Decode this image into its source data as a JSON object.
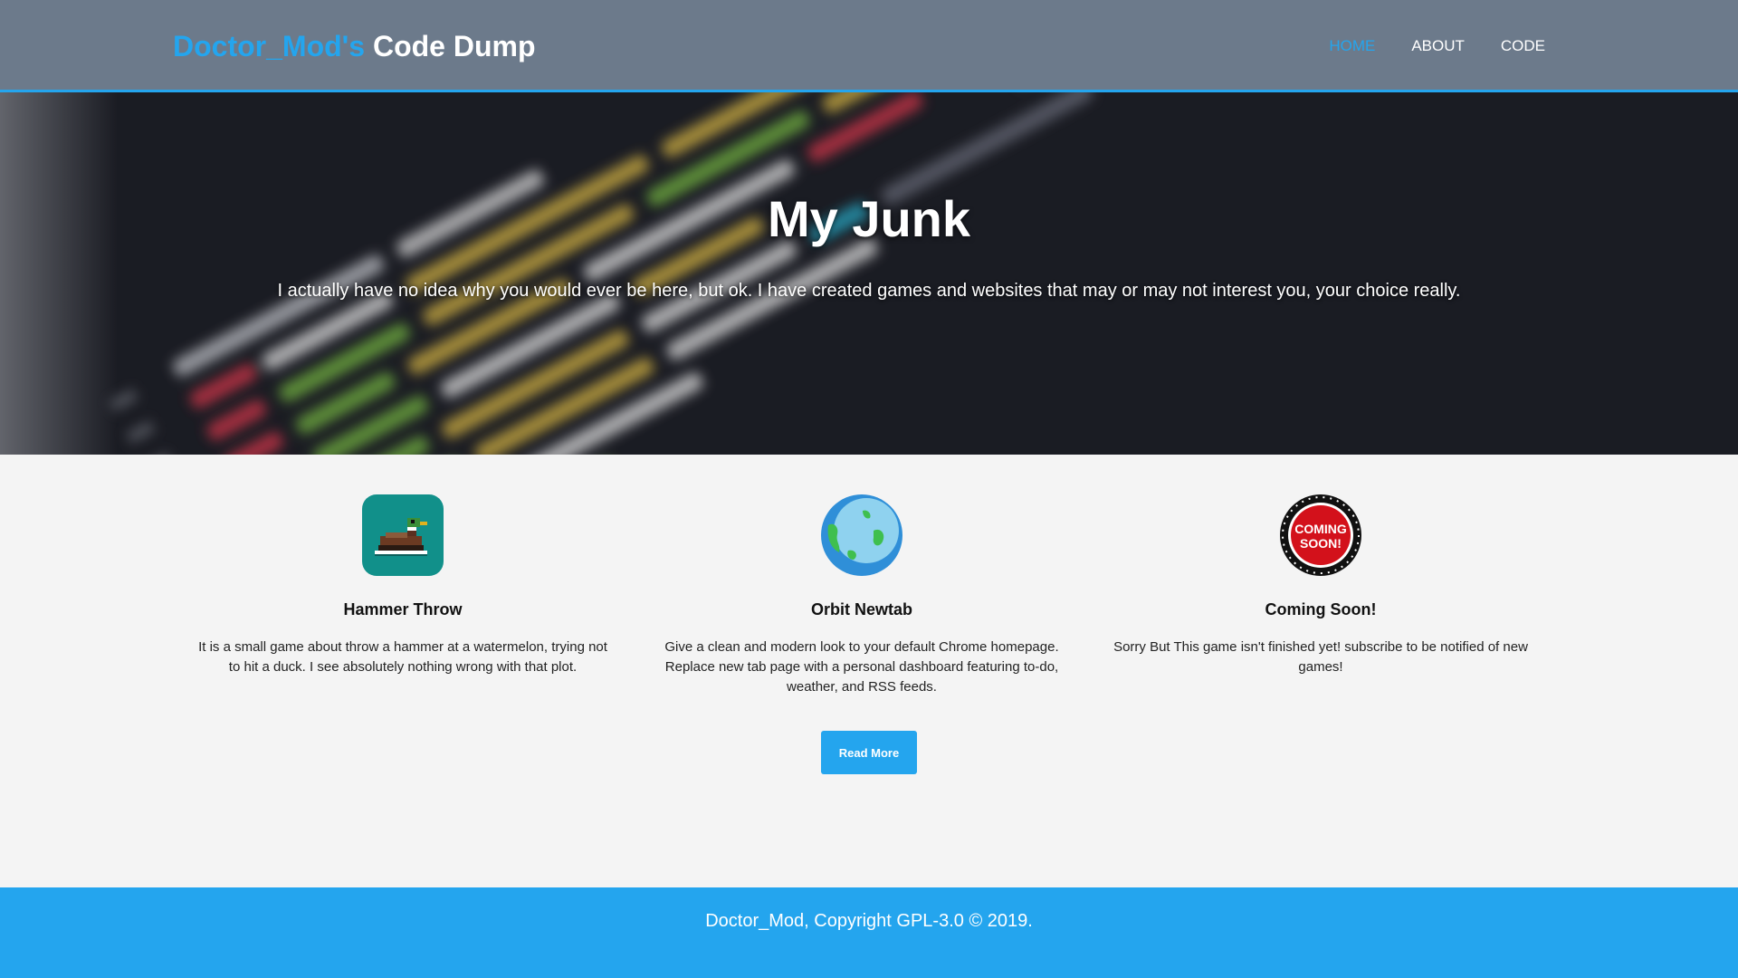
{
  "header": {
    "brand_accent": "Doctor_Mod's",
    "brand_rest": "Code Dump",
    "nav": [
      {
        "label": "HOME",
        "active": true
      },
      {
        "label": "ABOUT",
        "active": false
      },
      {
        "label": "CODE",
        "active": false
      }
    ]
  },
  "hero": {
    "title": "My Junk",
    "subtitle": "I actually have no idea why you would ever be here, but ok. I have created games and websites that may or may not interest you, your choice really.",
    "background": "blurred-code-editor-image"
  },
  "projects": [
    {
      "icon": "duck-icon",
      "title": "Hammer Throw",
      "description": "It is a small game about throw a hammer at a watermelon, trying not to hit a duck. I see absolutely nothing wrong with that plot."
    },
    {
      "icon": "globe-icon",
      "title": "Orbit Newtab",
      "description": "Give a clean and modern look to your default Chrome homepage. Replace new tab page with a personal dashboard featuring to-do, weather, and RSS feeds."
    },
    {
      "icon": "coming-soon-badge-icon",
      "badge_text": "COMING SOON!",
      "title": "Coming Soon!",
      "description": "Sorry But This game isn't finished yet! subscribe to be notified of new games!"
    }
  ],
  "read_more_label": "Read More",
  "footer": {
    "text": "Doctor_Mod, Copyright GPL-3.0 © 2019."
  },
  "colors": {
    "accent": "#24a5ee",
    "header_bg": "#6c7a8b",
    "page_bg": "#f4f4f4",
    "hero_dark": "#1b1d23"
  }
}
